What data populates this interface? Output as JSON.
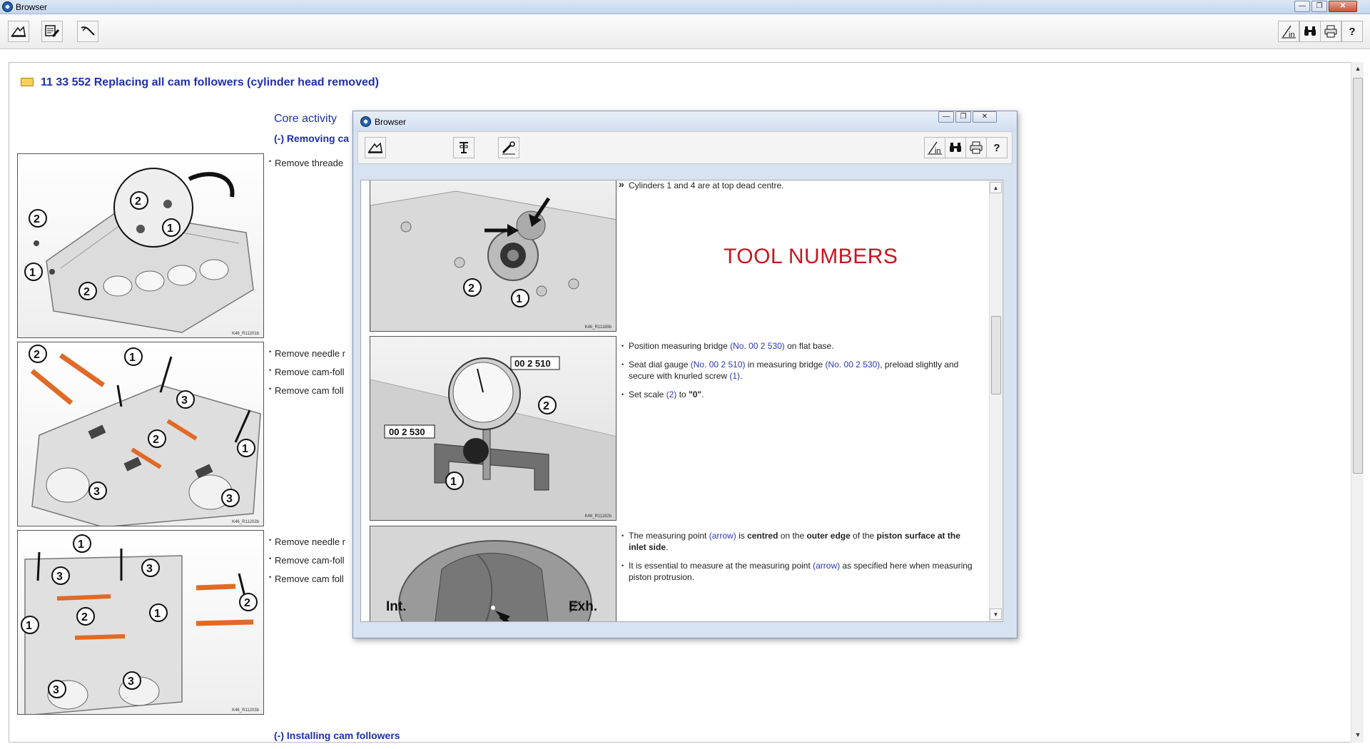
{
  "main_window": {
    "title": "Browser",
    "controls": {
      "minimize": "—",
      "restore": "❐",
      "close": "✕"
    }
  },
  "main_toolbar": {
    "left_icons": [
      "back-icon",
      "edit-note-icon",
      "tools-icon"
    ],
    "right_icons": [
      "info-icon",
      "binoculars-icon",
      "print-icon",
      "help-icon"
    ],
    "help_glyph": "?"
  },
  "document": {
    "title": "11 33 552 Replacing all cam followers (cylinder head removed)",
    "core_activity": "Core activity",
    "removing_heading": "(-) Removing ca",
    "installing_heading": "(-) Installing cam followers",
    "bullets_group1": [
      "Remove threade"
    ],
    "bullets_group2": [
      "Remove needle r",
      "Remove cam-foll",
      "Remove cam foll"
    ],
    "bullets_group3": [
      "Remove needle r",
      "Remove cam-foll",
      "Remove cam foll"
    ],
    "figure_refs": [
      "K46_R11201b",
      "K46_R11202b",
      "K46_R11203b"
    ]
  },
  "popup_window": {
    "title": "Browser",
    "controls": {
      "minimize": "—",
      "restore": "❐",
      "close": "✕"
    },
    "toolbar_left_icons": [
      "back-icon",
      "tool-icon",
      "wrench-icon"
    ],
    "toolbar_right_icons": [
      "info-icon",
      "binoculars-icon",
      "print-icon",
      "help-icon"
    ],
    "help_glyph": "?",
    "step1_text": "Cylinders 1 and 4 are at top dead centre.",
    "tool_numbers": "TOOL NUMBERS",
    "step2": {
      "b1_pre": "Position measuring bridge ",
      "b1_link": "(No. 00 2 530)",
      "b1_post": " on flat base.",
      "b2_pre": "Seat dial gauge ",
      "b2_link1": "(No. 00 2 510)",
      "b2_mid": " in measuring bridge ",
      "b2_link2": "(No. 00 2 530)",
      "b2_post": ", preload slightly and secure with knurled screw ",
      "b2_link3": "(1)",
      "b2_end": ".",
      "b3_pre": "Set scale ",
      "b3_link": "(2)",
      "b3_mid": " to ",
      "b3_bold": "\"0\"",
      "b3_end": "."
    },
    "step3": {
      "b1_pre": "The measuring point ",
      "b1_link": "(arrow)",
      "b1_mid1": " is ",
      "b1_bold1": "centred",
      "b1_mid2": " on the ",
      "b1_bold2": "outer edge",
      "b1_mid3": " of the ",
      "b1_bold3": "piston surface at the inlet side",
      "b1_end": ".",
      "b2_pre": "It is essential to measure at the measuring point ",
      "b2_link": "(arrow)",
      "b2_post": " as specified here when measuring piston protrusion."
    },
    "figure_labels": {
      "tool_gauge": "00 2 510",
      "tool_bridge": "00 2 530",
      "intake": "Int.",
      "exhaust": "Exh."
    },
    "figure_refs": [
      "K46_R11189b",
      "K46_R11182b"
    ]
  }
}
